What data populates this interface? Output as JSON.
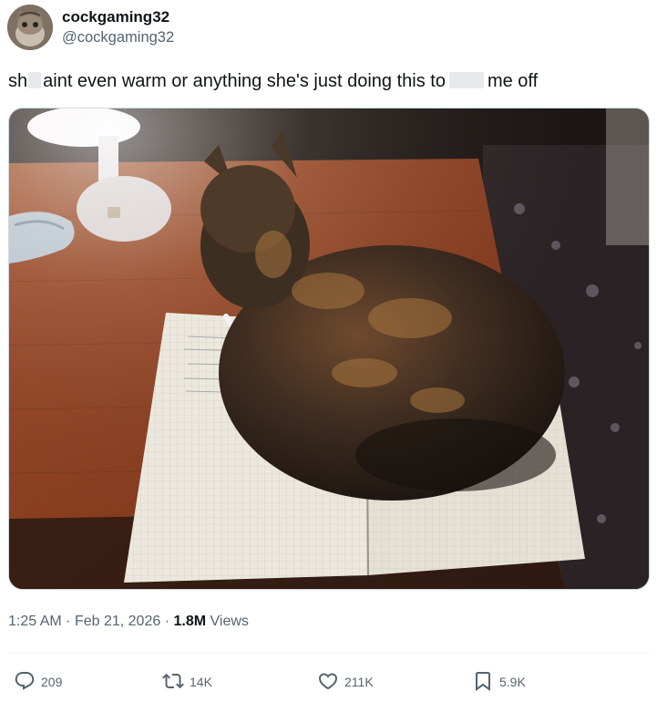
{
  "tweet": {
    "display_name": "cockgaming32",
    "handle": "@cockgaming32",
    "text_part1": "sh",
    "text_part2": "aint even warm or anything she's just doing this to",
    "text_part3": "me off",
    "time": "1:25 AM",
    "sep": "·",
    "date": "Feb 21, 2026",
    "views_count": "1.8M",
    "views_label": "Views"
  },
  "actions": {
    "replies": "209",
    "retweets": "14K",
    "likes": "211K",
    "bookmarks": "5.9K"
  },
  "icons": {
    "reply": "reply-icon",
    "retweet": "retweet-icon",
    "like": "heart-icon",
    "bookmark": "bookmark-icon"
  },
  "colors": {
    "text": "#0f1419",
    "muted": "#536471",
    "border": "#cfd9de"
  }
}
